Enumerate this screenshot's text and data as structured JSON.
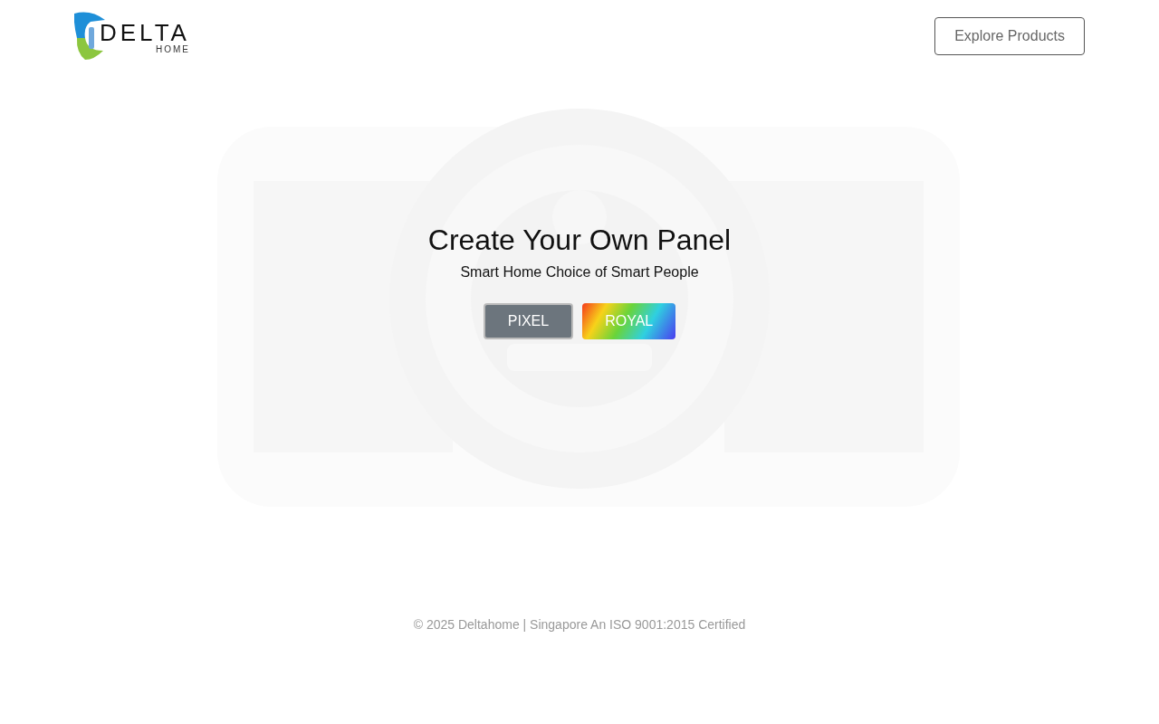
{
  "header": {
    "logo": {
      "word": "DELTA",
      "sub": "HOME"
    },
    "button": "Explore Products"
  },
  "hero": {
    "title": "Create Your Own Panel",
    "subtitle": "Smart Home Choice of Smart People",
    "options": [
      {
        "label": "PIXEL",
        "kind": "solid",
        "selected": true
      },
      {
        "label": "ROYAL",
        "kind": "rainbow",
        "selected": false
      }
    ]
  },
  "footer": "© 2025 Deltahome | Singapore An ISO 9001:2015 Certified"
}
